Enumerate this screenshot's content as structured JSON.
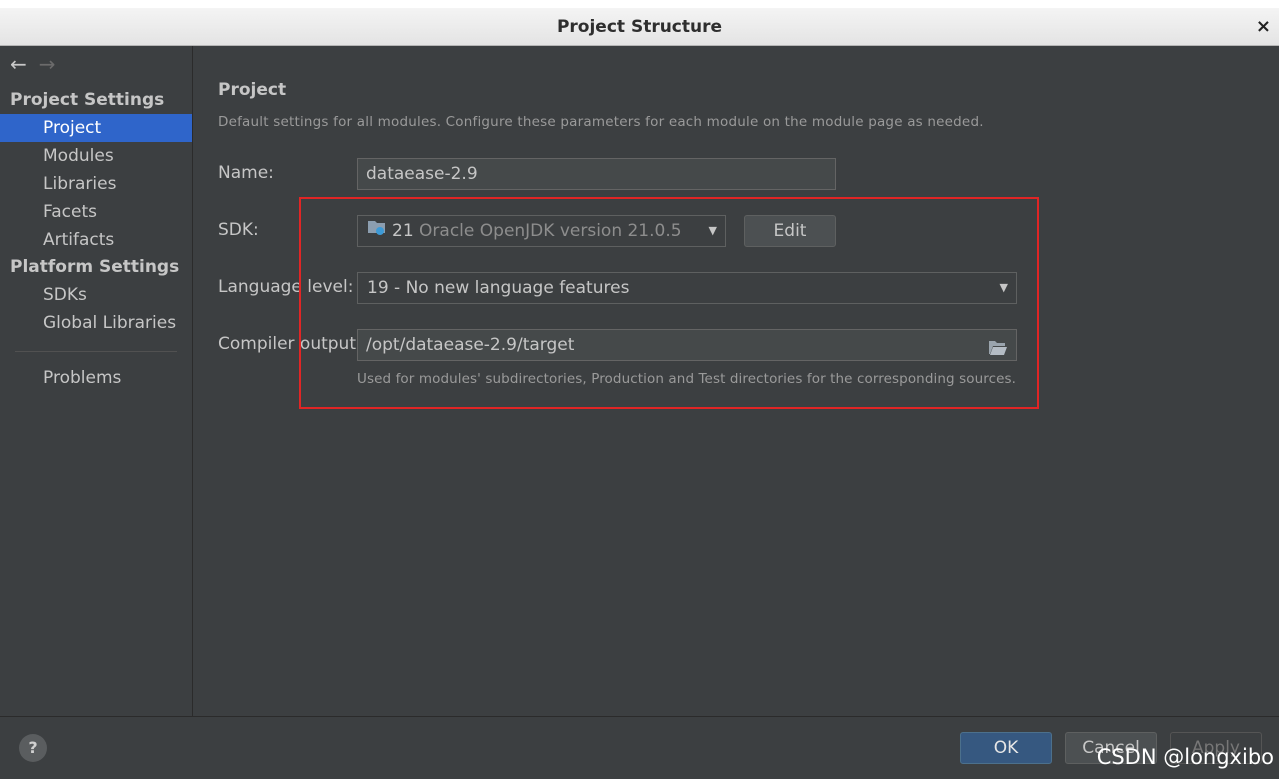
{
  "window": {
    "title": "Project Structure",
    "close_glyph": "×"
  },
  "sidebar": {
    "back_glyph": "←",
    "forward_glyph": "→",
    "project_settings_title": "Project Settings",
    "project_items": [
      "Project",
      "Modules",
      "Libraries",
      "Facets",
      "Artifacts"
    ],
    "platform_settings_title": "Platform Settings",
    "platform_items": [
      "SDKs",
      "Global Libraries"
    ],
    "problems_label": "Problems",
    "selected": "Project"
  },
  "main": {
    "title": "Project",
    "description": "Default settings for all modules. Configure these parameters for each module on the module page as needed.",
    "name_label": "Name:",
    "name_value": "dataease-2.9",
    "sdk_label": "SDK:",
    "sdk_version": "21",
    "sdk_name": "Oracle OpenJDK version 21.0.5",
    "edit_label": "Edit",
    "language_level_label": "Language level:",
    "language_level_value": "19 - No new language features",
    "compiler_output_label": "Compiler output:",
    "compiler_output_value": "/opt/dataease-2.9/target",
    "compiler_output_hint": "Used for modules' subdirectories, Production and Test directories for the corresponding sources."
  },
  "footer": {
    "help_glyph": "?",
    "ok_label": "OK",
    "cancel_label": "Cancel",
    "apply_label": "Apply",
    "watermark": "CSDN @longxibo"
  },
  "colors": {
    "selection": "#2f65ca",
    "highlight_box": "#e02525",
    "ok_button": "#365880"
  }
}
